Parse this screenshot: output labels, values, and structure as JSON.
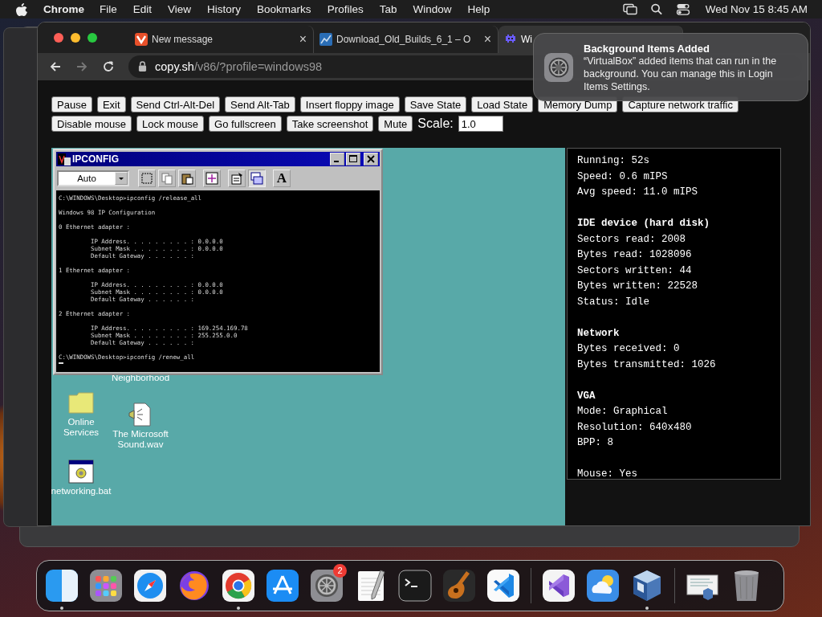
{
  "menubar": {
    "app": "Chrome",
    "menus": [
      "File",
      "Edit",
      "View",
      "History",
      "Bookmarks",
      "Profiles",
      "Tab",
      "Window",
      "Help"
    ],
    "clock": "Wed Nov 15  8:45 AM"
  },
  "browser": {
    "tabs": [
      {
        "title": "New message",
        "kind": "chevron",
        "selected": false,
        "close": "×"
      },
      {
        "title": "Download_Old_Builds_6_1 – O",
        "kind": "chart",
        "selected": false,
        "close": "×"
      },
      {
        "title": "Wi",
        "kind": "creature",
        "selected": true
      }
    ],
    "forward_enabled": false,
    "url": {
      "host": "copy.sh",
      "path": "/v86/?profile=windows98"
    }
  },
  "controls": [
    {
      "buttons": [
        "Pause",
        "Exit",
        "Send Ctrl-Alt-Del",
        "Send Alt-Tab",
        "Insert floppy image",
        "Save State",
        "Load State",
        "Memory Dump",
        "Capture network traffic"
      ]
    },
    {
      "buttons": [
        "Disable mouse",
        "Lock mouse",
        "Go fullscreen",
        "Take screenshot",
        "Mute"
      ],
      "scale": {
        "label": "Scale:",
        "value": "1.0"
      }
    }
  ],
  "console_window": {
    "title": "IPCONFIG",
    "font_size": "Auto",
    "tools": [
      {
        "kind": "mark",
        "pressed": false
      },
      {
        "kind": "copy",
        "pressed": false
      },
      {
        "kind": "paste",
        "pressed": false
      },
      {
        "kind": "fullscreen",
        "pressed": false
      },
      {
        "kind": "properties",
        "pressed": false
      },
      {
        "kind": "background",
        "pressed": true
      },
      {
        "kind": "font",
        "label": "A",
        "pressed": false
      }
    ],
    "blocks": [
      {
        "kind": "command",
        "lines": [
          "C:\\WINDOWS\\Desktop>ipconfig /release_all"
        ]
      },
      {
        "kind": "text",
        "lines": [
          "Windows 98 IP Configuration"
        ]
      },
      {
        "kind": "text",
        "lines": [
          "0 Ethernet adapter :"
        ]
      },
      {
        "kind": "details",
        "lines": [
          "IP Address. . . . . . . . . : 0.0.0.0",
          "Subnet Mask . . . . . . . . : 0.0.0.0",
          "Default Gateway . . . . . . :"
        ]
      },
      {
        "kind": "text",
        "lines": [
          "1 Ethernet adapter :"
        ]
      },
      {
        "kind": "details",
        "lines": [
          "IP Address. . . . . . . . . : 0.0.0.0",
          "Subnet Mask . . . . . . . . : 0.0.0.0",
          "Default Gateway . . . . . . :"
        ]
      },
      {
        "kind": "text",
        "lines": [
          "2 Ethernet adapter :"
        ]
      },
      {
        "kind": "details",
        "lines": [
          "IP Address. . . . . . . . . : 169.254.169.78",
          "Subnet Mask . . . . . . . . : 255.255.0.0",
          "Default Gateway . . . . . . :"
        ]
      },
      {
        "kind": "command",
        "lines": [
          "C:\\WINDOWS\\Desktop>ipconfig /renew_all"
        ]
      }
    ],
    "cursor": true
  },
  "desktop_icons": [
    {
      "kind": "label",
      "label": "Neighborhood"
    },
    {
      "kind": "folder",
      "label": "Online Services"
    },
    {
      "kind": "sound",
      "label": "The Microsoft Sound.wav"
    },
    {
      "kind": "batch",
      "label": "networking.bat"
    }
  ],
  "stats": [
    {
      "lines": [
        "Running: 52s",
        "Speed: 0.6 mIPS",
        "Avg speed: 11.0 mIPS"
      ]
    },
    {
      "title": "IDE device (hard disk)",
      "lines": [
        "Sectors read: 2008",
        "Bytes read: 1028096",
        "Sectors written: 44",
        "Bytes written: 22528",
        "Status: Idle"
      ]
    },
    {
      "title": "Network",
      "lines": [
        "Bytes received: 0",
        "Bytes transmitted: 1026"
      ]
    },
    {
      "title": "VGA",
      "lines": [
        "Mode: Graphical",
        "Resolution: 640x480",
        "BPP: 8"
      ]
    },
    {
      "lines": [
        "Mouse: Yes"
      ]
    }
  ],
  "notification": {
    "title": "Background Items Added",
    "body": "“VirtualBox” added items that can run in the background. You can manage this in Login Items Settings."
  },
  "dock": [
    [
      {
        "kind": "finder",
        "running": true
      },
      {
        "kind": "launchpad",
        "running": false
      },
      {
        "kind": "safari",
        "running": false
      },
      {
        "kind": "firefox",
        "running": false
      },
      {
        "kind": "chrome",
        "running": true
      },
      {
        "kind": "appstore",
        "running": false
      },
      {
        "kind": "settings",
        "running": false,
        "badge": "2"
      },
      {
        "kind": "textedit",
        "running": false
      },
      {
        "kind": "terminal",
        "running": false
      },
      {
        "kind": "guitar",
        "running": false
      },
      {
        "kind": "code",
        "running": false
      }
    ],
    [
      {
        "kind": "studio",
        "running": false
      },
      {
        "kind": "weather",
        "running": false
      },
      {
        "kind": "cube",
        "running": true
      }
    ],
    [
      {
        "kind": "document",
        "running": false
      },
      {
        "kind": "trash",
        "running": false
      }
    ]
  ]
}
